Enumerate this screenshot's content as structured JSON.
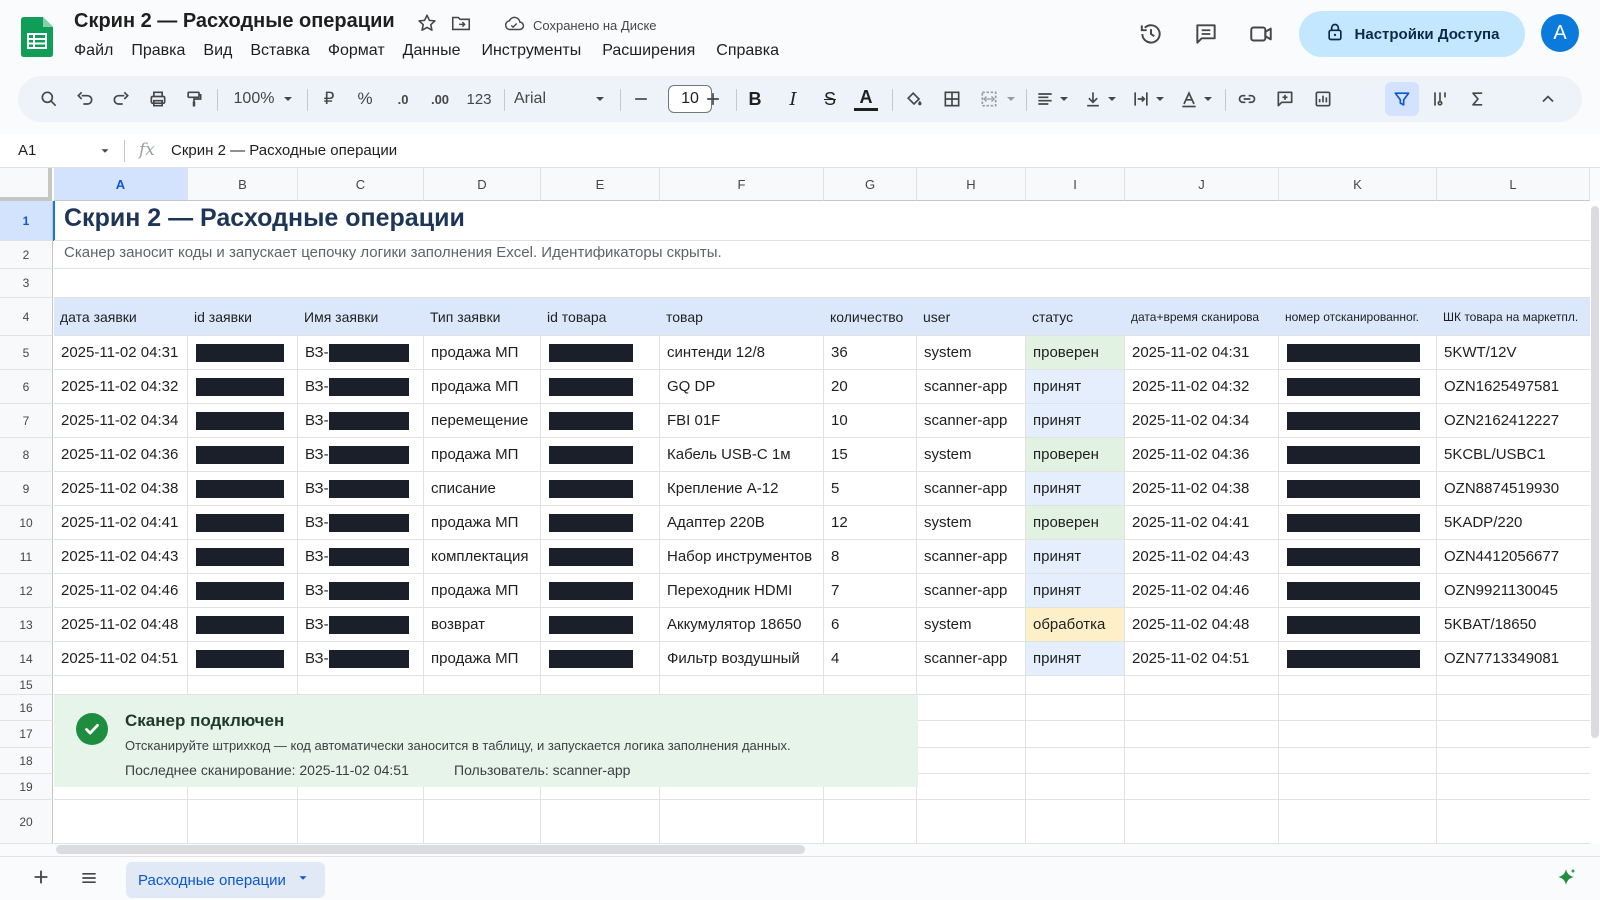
{
  "doc": {
    "title": "Скрин 2 — Расходные операции",
    "saved_status": "Сохранено на Диске"
  },
  "menu": [
    "Файл",
    "Правка",
    "Вид",
    "Вставка",
    "Формат",
    "Данные",
    "Инструменты",
    "Расширения",
    "Справка"
  ],
  "header": {
    "share_label": "Настройки Доступа",
    "avatar_letter": "A"
  },
  "toolbar": {
    "zoom": "100%",
    "currency": "₽",
    "percent": "%",
    "dec_minus": ".0",
    "dec_plus": ".00",
    "format_123": "123",
    "font": "Arial",
    "font_size": "10",
    "bold": "B",
    "italic": "I",
    "strike": "S",
    "text_color": "A"
  },
  "formula_bar": {
    "cell_ref": "A1",
    "fx": "fx",
    "value": "Скрин 2 — Расходные операции"
  },
  "columns": [
    "A",
    "B",
    "C",
    "D",
    "E",
    "F",
    "G",
    "H",
    "I",
    "J",
    "K",
    "L"
  ],
  "rows": [
    "1",
    "2",
    "3",
    "4",
    "5",
    "6",
    "7",
    "8",
    "9",
    "10",
    "11",
    "12",
    "13",
    "14",
    "15",
    "16",
    "17",
    "18",
    "19",
    "20"
  ],
  "sheet": {
    "title": "Скрин 2 — Расходные операции",
    "subtitle": "Сканер заносит коды и запускает цепочку логики заполнения Excel. Идентификаторы скрыты.",
    "headers": [
      "дата заявки",
      "id заявки",
      "Имя заявки",
      "Тип заявки",
      "id товара",
      "товар",
      "количество",
      "user",
      "статус",
      "дата+время сканирова",
      "номер отсканированног.",
      "ШК товара на маркетпл."
    ],
    "name_prefix": "ВЗ-",
    "rows": [
      {
        "date": "2025-11-02 04:31",
        "type": "продажа МП",
        "product": "синтенди 12/8",
        "qty": "36",
        "user": "system",
        "status": "проверен",
        "status_kind": "checked",
        "scan_time": "2025-11-02 04:31",
        "barcode": "5KWT/12V"
      },
      {
        "date": "2025-11-02 04:32",
        "type": "продажа МП",
        "product": "GQ DP",
        "qty": "20",
        "user": "scanner-app",
        "status": "принят",
        "status_kind": "accepted",
        "scan_time": "2025-11-02 04:32",
        "barcode": "OZN1625497581"
      },
      {
        "date": "2025-11-02 04:34",
        "type": "перемещение",
        "product": "FBI 01F",
        "qty": "10",
        "user": "scanner-app",
        "status": "принят",
        "status_kind": "accepted",
        "scan_time": "2025-11-02 04:34",
        "barcode": "OZN2162412227"
      },
      {
        "date": "2025-11-02 04:36",
        "type": "продажа МП",
        "product": "Кабель USB-C 1м",
        "qty": "15",
        "user": "system",
        "status": "проверен",
        "status_kind": "checked",
        "scan_time": "2025-11-02 04:36",
        "barcode": "5KCBL/USBC1"
      },
      {
        "date": "2025-11-02 04:38",
        "type": "списание",
        "product": "Крепление А-12",
        "qty": "5",
        "user": "scanner-app",
        "status": "принят",
        "status_kind": "accepted",
        "scan_time": "2025-11-02 04:38",
        "barcode": "OZN8874519930"
      },
      {
        "date": "2025-11-02 04:41",
        "type": "продажа МП",
        "product": "Адаптер 220В",
        "qty": "12",
        "user": "system",
        "status": "проверен",
        "status_kind": "checked",
        "scan_time": "2025-11-02 04:41",
        "barcode": "5KADP/220"
      },
      {
        "date": "2025-11-02 04:43",
        "type": "комплектация",
        "product": "Набор инструментов",
        "qty": "8",
        "user": "scanner-app",
        "status": "принят",
        "status_kind": "accepted",
        "scan_time": "2025-11-02 04:43",
        "barcode": "OZN4412056677"
      },
      {
        "date": "2025-11-02 04:46",
        "type": "продажа МП",
        "product": "Переходник HDMI",
        "qty": "7",
        "user": "scanner-app",
        "status": "принят",
        "status_kind": "accepted",
        "scan_time": "2025-11-02 04:46",
        "barcode": "OZN9921130045"
      },
      {
        "date": "2025-11-02 04:48",
        "type": "возврат",
        "product": "Аккумулятор 18650",
        "qty": "6",
        "user": "system",
        "status": "обработка",
        "status_kind": "processing",
        "scan_time": "2025-11-02 04:48",
        "barcode": "5KBAT/18650"
      },
      {
        "date": "2025-11-02 04:51",
        "type": "продажа МП",
        "product": "Фильтр воздушный",
        "qty": "4",
        "user": "scanner-app",
        "status": "принят",
        "status_kind": "accepted",
        "scan_time": "2025-11-02 04:51",
        "barcode": "OZN7713349081"
      }
    ]
  },
  "banner": {
    "title": "Сканер подключен",
    "text": "Отсканируйте штрихкод — код автоматически заносится в таблицу, и запускается логика заполнения данных.",
    "last_scan": "Последнее сканирование: 2025-11-02 04:51",
    "user": "Пользователь: scanner-app"
  },
  "bottom": {
    "sheet_tab": "Расходные операции"
  },
  "colors": {
    "accent": "#0b57d0",
    "header_band": "#dbe8fb",
    "status_checked": "#e1f2e3",
    "status_accepted": "#e4eefc",
    "status_processing": "#fdf0c8",
    "banner_bg": "#e6f4ea",
    "redaction": "#1b1f2a"
  }
}
